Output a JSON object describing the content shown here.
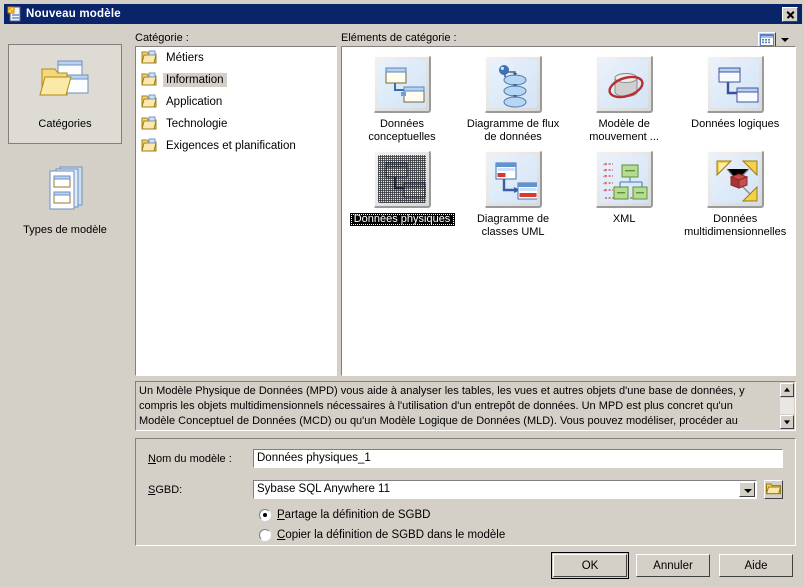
{
  "window": {
    "title": "Nouveau modèle",
    "icon": "new-model-icon",
    "close_label": "×"
  },
  "sidebar": {
    "items": [
      {
        "label": "Catégories",
        "icon": "folder-documents-icon",
        "selected": true
      },
      {
        "label": "Types de modèle",
        "icon": "stacked-documents-icon",
        "selected": false
      }
    ]
  },
  "category_panel": {
    "label": "Catégorie :",
    "items": [
      {
        "label": "Métiers",
        "icon": "folder-icon",
        "selected": false
      },
      {
        "label": "Information",
        "icon": "folder-icon",
        "selected": true
      },
      {
        "label": "Application",
        "icon": "folder-icon",
        "selected": false
      },
      {
        "label": "Technologie",
        "icon": "folder-icon",
        "selected": false
      },
      {
        "label": "Exigences et planification",
        "icon": "folder-icon",
        "selected": false
      }
    ]
  },
  "elements_panel": {
    "label": "Eléments de catégorie :",
    "view_button_icon": "grid-view-icon",
    "items": [
      {
        "label": "Données conceptuelles",
        "icon": "conceptual-data-icon",
        "selected": false
      },
      {
        "label": "Diagramme de flux de données",
        "icon": "data-flow-diagram-icon",
        "selected": false
      },
      {
        "label": "Modèle de mouvement ...",
        "icon": "data-movement-icon",
        "selected": false
      },
      {
        "label": "Données logiques",
        "icon": "logical-data-icon",
        "selected": false
      },
      {
        "label": "Données physiques",
        "icon": "physical-data-icon",
        "selected": true
      },
      {
        "label": "Diagramme de classes UML",
        "icon": "uml-class-diagram-icon",
        "selected": false
      },
      {
        "label": "XML",
        "icon": "xml-model-icon",
        "selected": false
      },
      {
        "label": "Données multidimensionnelles",
        "icon": "multidimensional-data-icon",
        "selected": false
      }
    ]
  },
  "description": {
    "text": "Un Modèle Physique de Données (MPD) vous aide à analyser les tables, les vues et autres objets d'une base de données, y compris les objets multidimensionnels nécessaires à l'utilisation d'un entrepôt de données. Un MPD est plus concret qu'un Modèle Conceptuel de Données (MCD) ou qu'un Modèle Logique de Données (MLD). Vous pouvez modéliser, procéder au reverse engineering et générer"
  },
  "form": {
    "model_name_label": "Nom du modèle :",
    "model_name_value": "Données physiques_1",
    "dbms_label": "SGBD:",
    "dbms_value": "Sybase SQL Anywhere 11",
    "browse_icon": "folder-open-icon",
    "radios": [
      {
        "label": "Partage la définition de SGBD",
        "selected": true
      },
      {
        "label": "Copier la définition de SGBD dans le modèle",
        "selected": false
      }
    ]
  },
  "footer": {
    "ok": "OK",
    "cancel": "Annuler",
    "help": "Aide"
  },
  "colors": {
    "titlebar": "#0a246a",
    "dialog_bg": "#d4d0c8",
    "field_bg": "#ffffff",
    "selection_bg": "#000000"
  }
}
